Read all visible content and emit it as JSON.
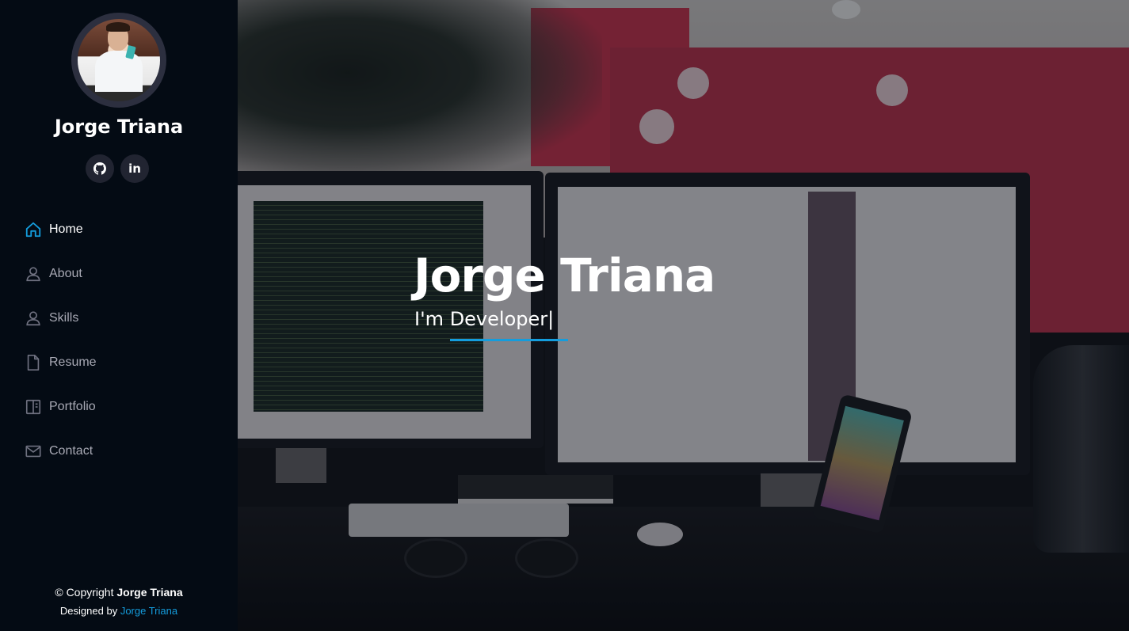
{
  "profile": {
    "name": "Jorge Triana",
    "social": [
      {
        "icon": "github-icon",
        "label": "GitHub"
      },
      {
        "icon": "linkedin-icon",
        "label": "in"
      }
    ]
  },
  "nav": {
    "items": [
      {
        "label": "Home",
        "icon": "home-icon",
        "active": true
      },
      {
        "label": "About",
        "icon": "person-icon",
        "active": false
      },
      {
        "label": "Skills",
        "icon": "person-icon",
        "active": false
      },
      {
        "label": "Resume",
        "icon": "file-icon",
        "active": false
      },
      {
        "label": "Portfolio",
        "icon": "book-half-icon",
        "active": false
      },
      {
        "label": "Contact",
        "icon": "envelope-icon",
        "active": false
      }
    ]
  },
  "hero": {
    "title": "Jorge Triana",
    "subtitle_prefix": "I'm ",
    "subtitle_typed": "Developer",
    "cursor": "|"
  },
  "footer": {
    "copyright_prefix": "© Copyright ",
    "copyright_name": "Jorge Triana",
    "credit_prefix": "Designed by ",
    "credit_link": "Jorge Triana"
  },
  "colors": {
    "accent": "#149ddd",
    "sidebar_bg": "#040b14",
    "nav_text": "#a8a9b4",
    "social_bg": "#212431"
  }
}
